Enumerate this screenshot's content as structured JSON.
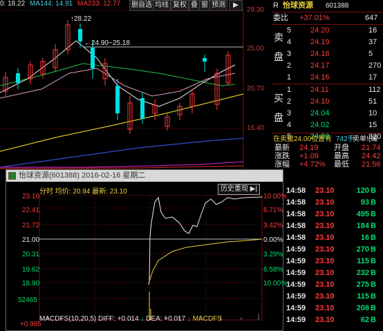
{
  "ma_bar": {
    "ma_a": "0: 18.22",
    "ma144": "MA144: 14.91",
    "ma233": "MA233: 12.77"
  },
  "toolbar": {
    "items": [
      "删自选",
      "均线",
      "复权",
      "叠",
      "窗",
      "预测"
    ]
  },
  "top_chart": {
    "price_labels": [
      "29.30",
      "25.00",
      "20.70",
      "16.40"
    ],
    "annotation_high": "28.22",
    "annotation_range": "24.90~25.18"
  },
  "book": {
    "header_prefix": "R",
    "name": "怡球资源",
    "code": "601388",
    "ratio_label": "委比",
    "ratio_value": "+37.01%",
    "ratio_right": "647",
    "sell_label": "卖盘",
    "buy_label": "买盘",
    "sells": [
      {
        "level": "5",
        "price": "24.20",
        "vol": "16"
      },
      {
        "level": "4",
        "price": "24.19",
        "vol": "37"
      },
      {
        "level": "3",
        "price": "24.18",
        "vol": "5"
      },
      {
        "level": "2",
        "price": "24.17",
        "vol": "270"
      },
      {
        "level": "1",
        "price": "24.16",
        "vol": "17"
      }
    ],
    "buys": [
      {
        "level": "1",
        "price": "24.11",
        "vol": "112"
      },
      {
        "level": "2",
        "price": "24.10",
        "vol": "51"
      },
      {
        "level": "3",
        "price": "24.04",
        "vol": "10"
      },
      {
        "level": "4",
        "price": "24.02",
        "vol": "15"
      },
      {
        "level": "5",
        "price": "24.00",
        "vol": "820"
      }
    ],
    "status": "在卖盘24.00位置有",
    "status_vol": "742手",
    "status_tail": "卖单!(编",
    "quote": [
      {
        "l": "最新",
        "v": "24.19",
        "l2": "开盘",
        "v2": "21.74"
      },
      {
        "l": "涨跌",
        "v": "+1.09",
        "l2": "最高",
        "v2": "24.42"
      },
      {
        "l": "涨幅",
        "v": "+4.72%",
        "l2": "最低",
        "v2": "21.56"
      }
    ]
  },
  "intraday": {
    "title": "怡球资源(601388) 2016-02-16 星期二",
    "info": "分时  均价: 20.94  最新: 23.10",
    "history_button": "历史重现",
    "left_labels": [
      "23.10",
      "22.41",
      "21.72",
      "21.00",
      "20.31",
      "19.62",
      "18.90"
    ],
    "right_labels": [
      "10.00%",
      "6.71%",
      "3.42%",
      "0.00%",
      "3.29%",
      "6.58%",
      "10.00%"
    ],
    "volume_label": "52465",
    "macd_min": "+0.985",
    "macd_text": "MACDFS(10,20,5) DIFF: +0.014",
    "dea_text": "DEA: +0.017",
    "macdfs_text": "MACDFS"
  },
  "ticks": [
    {
      "time": "14:58",
      "price": "23.10",
      "vol": "120"
    },
    {
      "time": "14:58",
      "price": "23.10",
      "vol": "93"
    },
    {
      "time": "14:58",
      "price": "23.10",
      "vol": "495"
    },
    {
      "time": "14:58",
      "price": "23.10",
      "vol": "184"
    },
    {
      "time": "14:58",
      "price": "23.10",
      "vol": "16"
    },
    {
      "time": "14:59",
      "price": "23.10",
      "vol": "270"
    },
    {
      "time": "14:59",
      "price": "23.10",
      "vol": "115"
    },
    {
      "time": "14:59",
      "price": "23.10",
      "vol": "232"
    },
    {
      "time": "14:59",
      "price": "23.10",
      "vol": "275"
    },
    {
      "time": "14:59",
      "price": "23.10",
      "vol": "115"
    },
    {
      "time": "14:59",
      "price": "23.10",
      "vol": "208"
    },
    {
      "time": "14:59",
      "price": "23.10",
      "vol": "62"
    }
  ],
  "colors": {
    "up": "#ff3b3b",
    "down": "#00e070",
    "grid": "#7a1010"
  }
}
